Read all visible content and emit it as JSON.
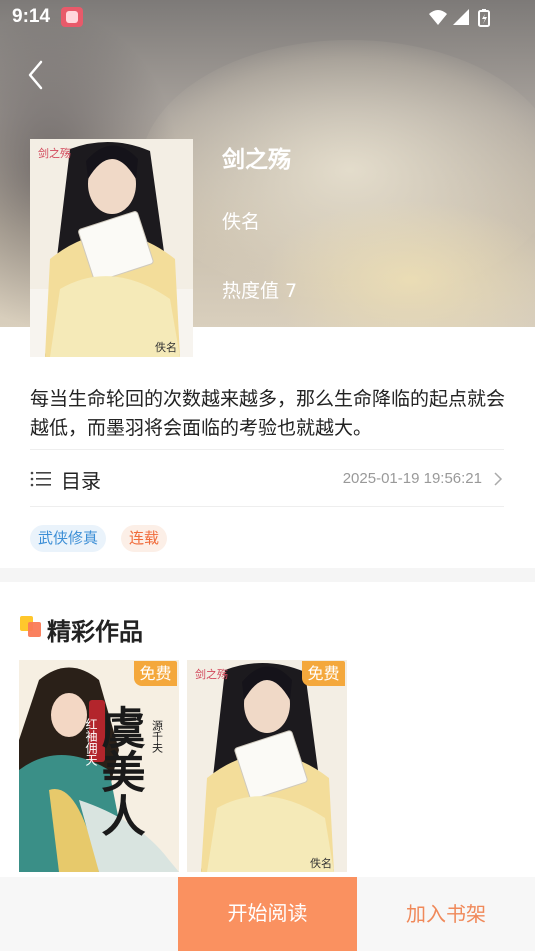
{
  "status_bar": {
    "time": "9:14"
  },
  "book": {
    "title": "剑之殇",
    "author": "佚名",
    "heat": "热度值 7",
    "cover_text_top": "剑之殇",
    "cover_text_bottom": "佚名",
    "description": "每当生命轮回的次数越来越多，那么生命降临的起点就会越低，而墨羽将会面临的考验也就越大。"
  },
  "toc": {
    "label": "目录",
    "updated": "2025-01-19 19:56:21"
  },
  "tags": [
    "武侠修真",
    "连载"
  ],
  "section": {
    "title": "精彩作品",
    "works": [
      {
        "badge": "免费",
        "cover_title": "虞美人",
        "cover_subtitle": "红袖佣天",
        "cover_author": "源千夫"
      },
      {
        "badge": "免费",
        "cover_title": "剑之殇",
        "cover_author": "佚名"
      }
    ]
  },
  "bottom": {
    "start_reading": "开始阅读",
    "add_shelf": "加入书架"
  },
  "colors": {
    "accent": "#fa9160",
    "shelf_text": "#f0895a",
    "tag_blue": "#3d8fd6",
    "tag_orange": "#f06b3a",
    "badge": "#f4a83c"
  }
}
